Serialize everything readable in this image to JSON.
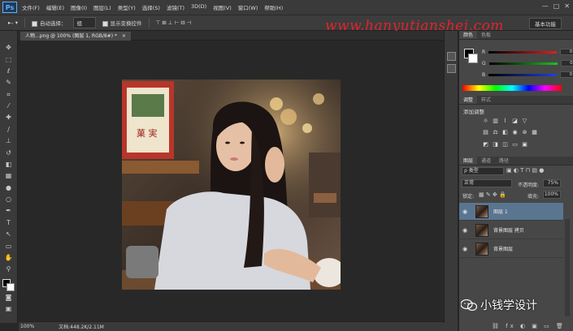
{
  "menubar": {
    "logo": "Ps",
    "items": [
      "文件(F)",
      "编辑(E)",
      "图像(I)",
      "图层(L)",
      "类型(Y)",
      "选择(S)",
      "滤镜(T)",
      "3D(D)",
      "视图(V)",
      "窗口(W)",
      "帮助(H)"
    ],
    "window_controls": [
      "—",
      "□",
      "✕"
    ]
  },
  "options": {
    "auto_select_label": "自动选择：",
    "auto_select_value": "组",
    "show_transform_label": "显示变换控件",
    "workspace": "基本功能",
    "watermark": "www.hanyutianshei.com"
  },
  "document": {
    "tab_title": "人物...png @ 100% (图层 1, RGB/8#) *",
    "close": "×"
  },
  "status": {
    "zoom": "100%",
    "doc": "文档:448.2K/2.11M"
  },
  "color_panel": {
    "tabs": [
      "颜色",
      "色板"
    ],
    "channels": [
      {
        "label": "R",
        "value": "0",
        "color": "#e02020"
      },
      {
        "label": "G",
        "value": "0",
        "color": "#20c020"
      },
      {
        "label": "B",
        "value": "0",
        "color": "#2040e0"
      }
    ]
  },
  "adjustments_panel": {
    "tabs": [
      "调整",
      "样式"
    ],
    "title": "添加调整"
  },
  "layers_panel": {
    "tabs": [
      "图层",
      "通道",
      "路径"
    ],
    "kind_label": "ρ 类型",
    "blend_mode": "正常",
    "opacity_label": "不透明度:",
    "opacity_value": "75%",
    "lock_label": "锁定:",
    "fill_label": "填充:",
    "fill_value": "100%",
    "layers": [
      {
        "name": "图层 1",
        "selected": true
      },
      {
        "name": "背景图层 拷贝",
        "selected": false
      },
      {
        "name": "背景图层",
        "selected": false
      }
    ]
  },
  "watermark_bottom": {
    "text": "小钱学设计"
  },
  "colors": {
    "accent_selected": "#5a7590",
    "watermark_red": "#e1242c"
  }
}
